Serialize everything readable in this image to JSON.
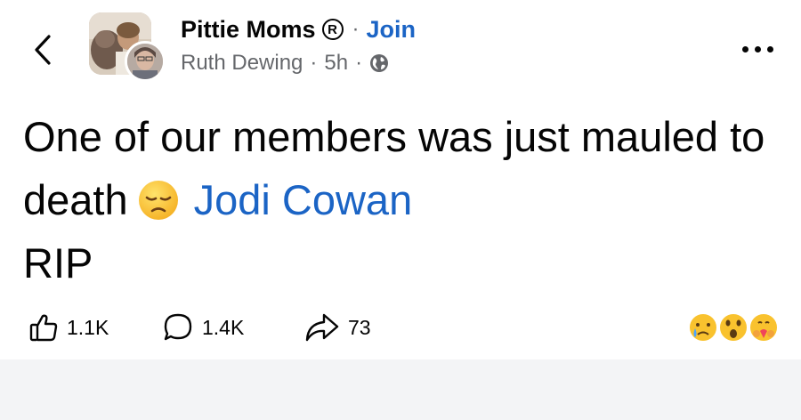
{
  "header": {
    "group_name": "Pittie Moms",
    "registered_mark": "R",
    "separator": "·",
    "join_label": "Join",
    "author": "Ruth Dewing",
    "time": "5h",
    "audience_icon": "globe-icon"
  },
  "post": {
    "text_before": "One of our members was just mauled to death",
    "emoji": "disappointed-face-emoji",
    "mention": "Jodi Cowan",
    "text_after": "RIP"
  },
  "actions": {
    "likes": "1.1K",
    "comments": "1.4K",
    "shares": "73"
  },
  "reactions": [
    "crying-face",
    "astonished-face",
    "heart-hug-face"
  ],
  "colors": {
    "link": "#1b64c5",
    "text": "#050505",
    "muted": "#65676b",
    "footer_bg": "#f3f4f6"
  }
}
